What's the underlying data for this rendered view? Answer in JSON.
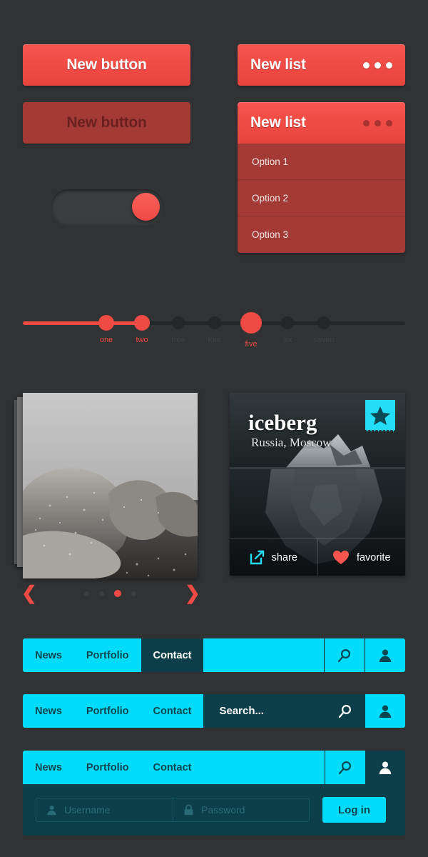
{
  "theme": {
    "background": "#303234",
    "accent_red": "#ef4a44",
    "accent_red_muted": "#a43a36",
    "accent_cyan": "#00dcfa",
    "accent_teal_dark": "#0c3f49"
  },
  "buttons": {
    "primary_label": "New button",
    "disabled_label": "New button"
  },
  "toggle": {
    "state": "on"
  },
  "lists": {
    "collapsed": {
      "title": "New list",
      "menu_icon": "ellipsis-icon"
    },
    "expanded": {
      "title": "New list",
      "menu_icon": "ellipsis-icon",
      "options": [
        "Option 1",
        "Option 2",
        "Option 3"
      ]
    }
  },
  "slider": {
    "steps": [
      {
        "label": "one",
        "active": true
      },
      {
        "label": "two",
        "active": true
      },
      {
        "label": "free",
        "active": false
      },
      {
        "label": "four",
        "active": false
      },
      {
        "label": "five",
        "active": true
      },
      {
        "label": "six",
        "active": false
      },
      {
        "label": "seven",
        "active": false
      }
    ]
  },
  "carousel": {
    "prev_icon": "chevron-left-icon",
    "next_icon": "chevron-right-icon",
    "dots": 4,
    "active_dot": 3
  },
  "card": {
    "title": "iceberg",
    "subtitle": "Russia, Moscow",
    "bookmark_icon": "star-bookmark-icon",
    "actions": [
      {
        "label": "share",
        "icon": "share-icon"
      },
      {
        "label": "favorite",
        "icon": "heart-icon"
      }
    ]
  },
  "navbars": [
    {
      "links": [
        {
          "label": "News",
          "active": false
        },
        {
          "label": "Portfolio",
          "active": false
        },
        {
          "label": "Contact",
          "active": true
        }
      ],
      "search_icon": "search-icon",
      "user_icon": "user-icon"
    },
    {
      "links": [
        {
          "label": "News",
          "active": false
        },
        {
          "label": "Portfolio",
          "active": false
        },
        {
          "label": "Contact",
          "active": false
        }
      ],
      "search_text": "Search...",
      "search_icon": "search-icon",
      "user_icon": "user-icon"
    },
    {
      "links": [
        {
          "label": "News",
          "active": false
        },
        {
          "label": "Portfolio",
          "active": false
        },
        {
          "label": "Contact",
          "active": false
        }
      ],
      "search_icon": "search-icon",
      "user_icon": "user-icon",
      "login": {
        "username_placeholder": "Username",
        "username_icon": "user-icon",
        "password_placeholder": "Password",
        "password_icon": "lock-icon",
        "submit_label": "Log in"
      }
    }
  ]
}
